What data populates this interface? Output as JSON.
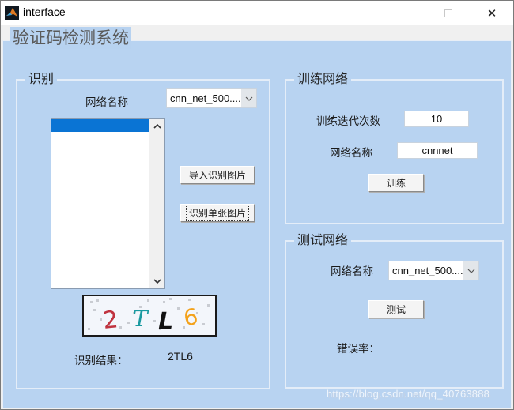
{
  "window": {
    "title": "interface",
    "icon": "matlab-icon",
    "controls": {
      "minimize": "minimize-icon",
      "maximize": "maximize-icon",
      "close": "✕"
    }
  },
  "app": {
    "title": "验证码检测系统"
  },
  "recognition": {
    "group_label": "识别",
    "network_label": "网络名称",
    "network_select": {
      "value": "cnn_net_500...."
    },
    "image_list": {
      "items": [
        ""
      ],
      "selected_index": 0
    },
    "import_button": "导入识别图片",
    "recognize_button": "识别单张图片",
    "captcha": {
      "chars": [
        {
          "char": "2",
          "color": "#c0333f"
        },
        {
          "char": "T",
          "color": "#1a9aa0"
        },
        {
          "char": "L",
          "color": "#111111"
        },
        {
          "char": "6",
          "color": "#f3a21b"
        }
      ]
    },
    "result_label": "识别结果：",
    "result_value": "2TL6"
  },
  "training": {
    "group_label": "训练网络",
    "iterations_label": "训练迭代次数",
    "iterations_value": "10",
    "network_label": "网络名称",
    "network_value": "cnnnet",
    "train_button": "训练"
  },
  "testing": {
    "group_label": "测试网络",
    "network_label": "网络名称",
    "network_select": {
      "value": "cnn_net_500...."
    },
    "test_button": "测试",
    "error_rate_label": "错误率："
  },
  "watermark": "https://blog.csdn.net/qq_40763888"
}
